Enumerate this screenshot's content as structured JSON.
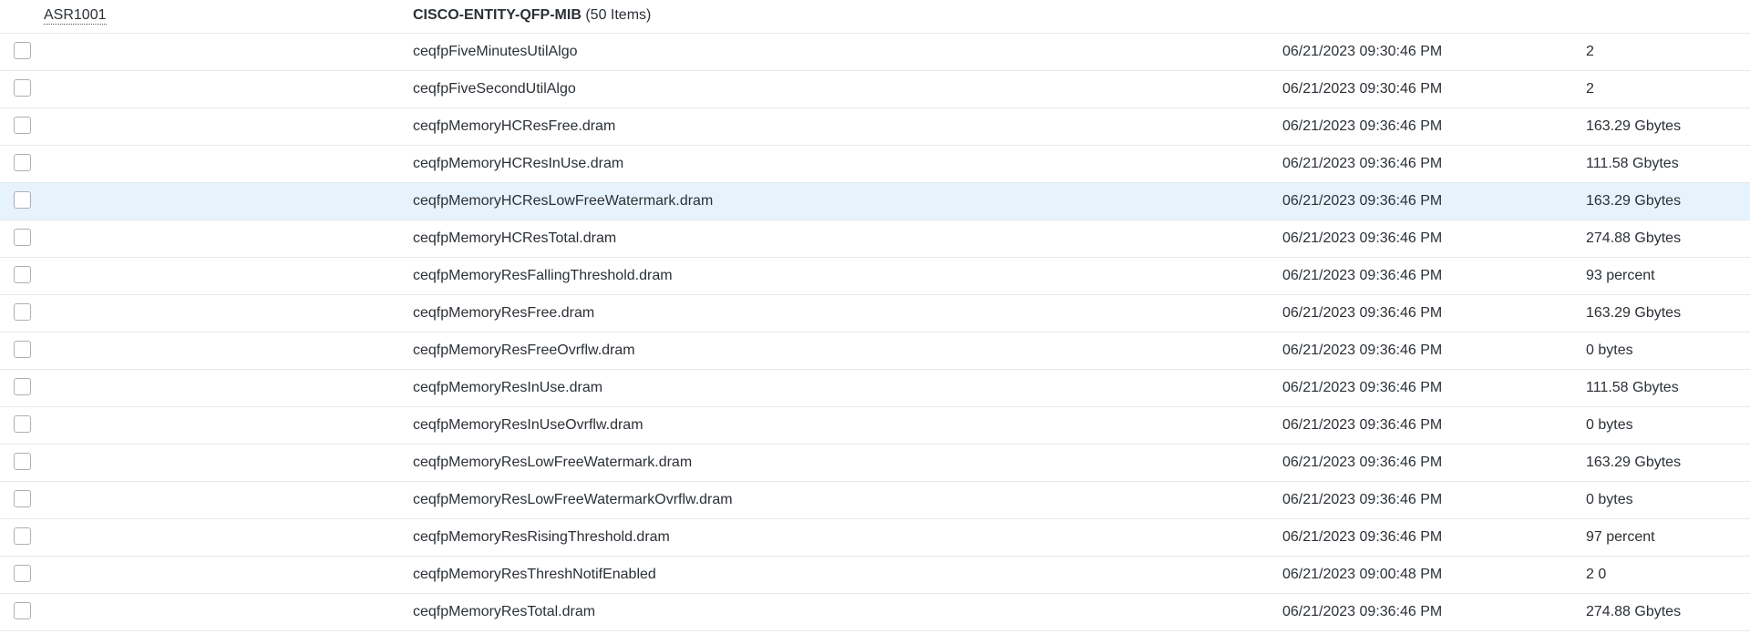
{
  "header": {
    "device": "ASR1001",
    "group": "CISCO-ENTITY-QFP-MIB",
    "count": "(50 Items)"
  },
  "highlighted_row": 4,
  "rows": [
    {
      "name": "ceqfpFiveMinutesUtilAlgo",
      "time": "06/21/2023 09:30:46 PM",
      "value": "2"
    },
    {
      "name": "ceqfpFiveSecondUtilAlgo",
      "time": "06/21/2023 09:30:46 PM",
      "value": "2"
    },
    {
      "name": "ceqfpMemoryHCResFree.dram",
      "time": "06/21/2023 09:36:46 PM",
      "value": "163.29 Gbytes"
    },
    {
      "name": "ceqfpMemoryHCResInUse.dram",
      "time": "06/21/2023 09:36:46 PM",
      "value": "111.58 Gbytes"
    },
    {
      "name": "ceqfpMemoryHCResLowFreeWatermark.dram",
      "time": "06/21/2023 09:36:46 PM",
      "value": "163.29 Gbytes"
    },
    {
      "name": "ceqfpMemoryHCResTotal.dram",
      "time": "06/21/2023 09:36:46 PM",
      "value": "274.88 Gbytes"
    },
    {
      "name": "ceqfpMemoryResFallingThreshold.dram",
      "time": "06/21/2023 09:36:46 PM",
      "value": "93 percent"
    },
    {
      "name": "ceqfpMemoryResFree.dram",
      "time": "06/21/2023 09:36:46 PM",
      "value": "163.29 Gbytes"
    },
    {
      "name": "ceqfpMemoryResFreeOvrflw.dram",
      "time": "06/21/2023 09:36:46 PM",
      "value": "0 bytes"
    },
    {
      "name": "ceqfpMemoryResInUse.dram",
      "time": "06/21/2023 09:36:46 PM",
      "value": "111.58 Gbytes"
    },
    {
      "name": "ceqfpMemoryResInUseOvrflw.dram",
      "time": "06/21/2023 09:36:46 PM",
      "value": "0 bytes"
    },
    {
      "name": "ceqfpMemoryResLowFreeWatermark.dram",
      "time": "06/21/2023 09:36:46 PM",
      "value": "163.29 Gbytes"
    },
    {
      "name": "ceqfpMemoryResLowFreeWatermarkOvrflw.dram",
      "time": "06/21/2023 09:36:46 PM",
      "value": "0 bytes"
    },
    {
      "name": "ceqfpMemoryResRisingThreshold.dram",
      "time": "06/21/2023 09:36:46 PM",
      "value": "97 percent"
    },
    {
      "name": "ceqfpMemoryResThreshNotifEnabled",
      "time": "06/21/2023 09:00:48 PM",
      "value": "2 0"
    },
    {
      "name": "ceqfpMemoryResTotal.dram",
      "time": "06/21/2023 09:36:46 PM",
      "value": "274.88 Gbytes"
    }
  ]
}
